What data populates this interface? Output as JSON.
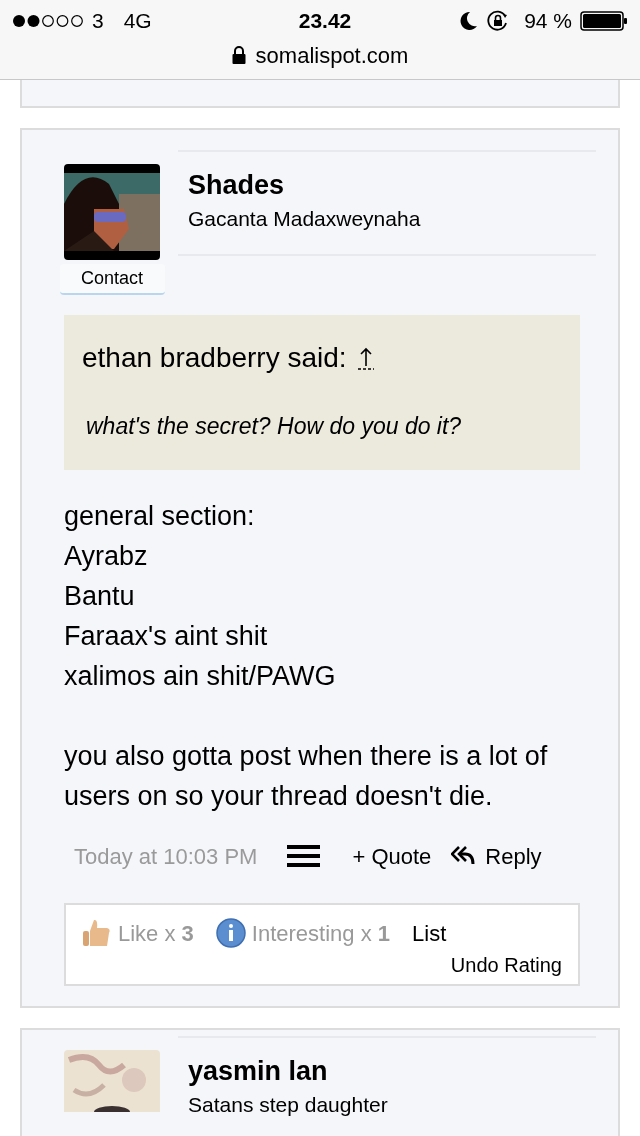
{
  "status_bar": {
    "carrier": "3",
    "network": "4G",
    "time": "23.42",
    "battery": "94 %"
  },
  "address_bar": {
    "url": "somalispot.com"
  },
  "posts": [
    {
      "username": "Shades",
      "user_title": "Gacanta Madaxweynaha",
      "contact_button": "Contact",
      "quote": {
        "author": "ethan bradberry said:",
        "text": "what's the secret? How do you do it?"
      },
      "body": [
        "general section:\nAyrabz\nBantu\nFaraax's aint shit\nxalimos ain shit/PAWG",
        "you also gotta post when there is a lot of users on so your thread doesn't die."
      ],
      "timestamp": "Today at 10:03 PM",
      "quote_button": "+ Quote",
      "reply_button": "Reply",
      "ratings": [
        {
          "kind": "like",
          "text": "Like x **3**"
        },
        {
          "kind": "interesting",
          "text": "Interesting x **1**"
        }
      ],
      "list_link": "List",
      "undo_link": "Undo Rating"
    },
    {
      "username": "yasmin lan",
      "user_title": "Satans step daughter"
    }
  ]
}
